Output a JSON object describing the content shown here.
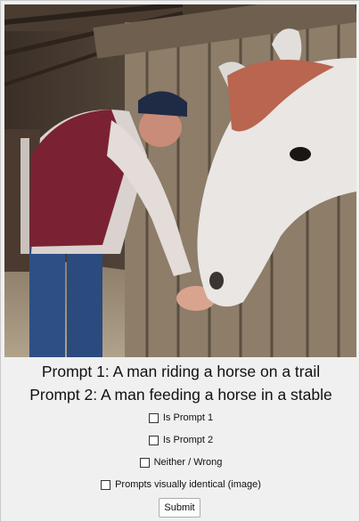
{
  "image": {
    "subject": "man-feeding-white-horse-in-stable"
  },
  "prompts": [
    {
      "text": "Prompt 1: A man riding a horse on a trail"
    },
    {
      "text": "Prompt 2: A man feeding a horse in a stable"
    }
  ],
  "options": [
    {
      "label": "Is Prompt 1",
      "checked": false
    },
    {
      "label": "Is Prompt 2",
      "checked": false
    },
    {
      "label": "Neither / Wrong",
      "checked": false
    },
    {
      "label": "Prompts visually identical (image)",
      "checked": false
    }
  ],
  "submit_label": "Submit",
  "colors": {
    "background": "#f0f0f0",
    "text": "#111111",
    "button_border": "#adadad"
  }
}
